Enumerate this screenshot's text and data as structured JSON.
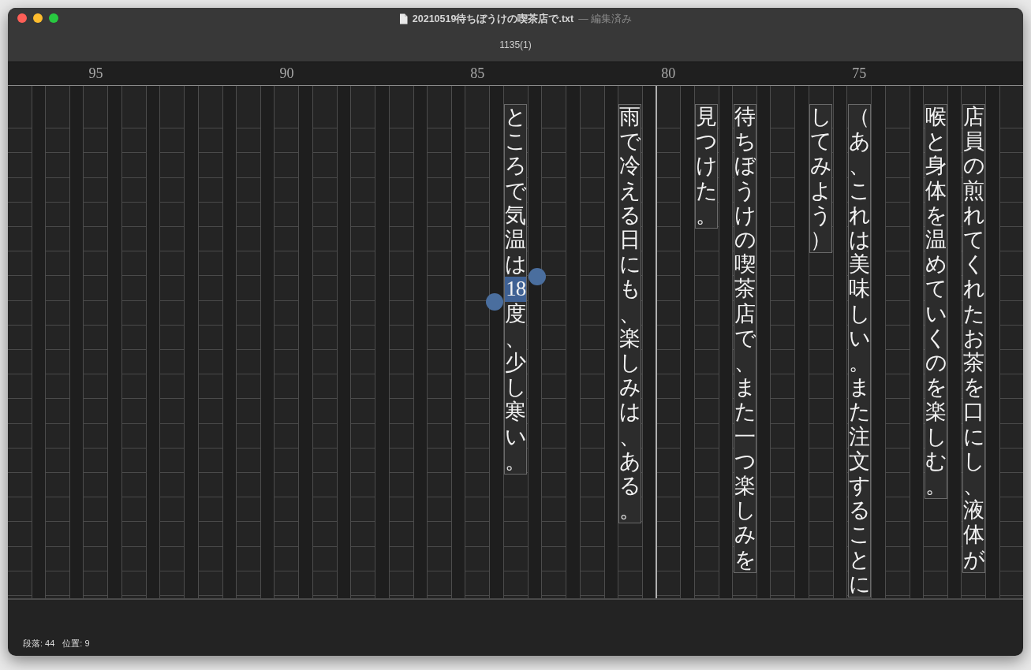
{
  "window": {
    "title": "20210519待ちぼうけの喫茶店で.txt",
    "subtitle_state": "— 編集済み",
    "page_info": "1135(1)"
  },
  "lines": [
    {
      "kind": "blank"
    },
    {
      "kind": "blank"
    },
    {
      "kind": "blank",
      "ruler_label": "95"
    },
    {
      "kind": "blank"
    },
    {
      "kind": "blank"
    },
    {
      "kind": "blank"
    },
    {
      "kind": "blank"
    },
    {
      "kind": "blank",
      "ruler_label": "90"
    },
    {
      "kind": "blank"
    },
    {
      "kind": "blank"
    },
    {
      "kind": "blank"
    },
    {
      "kind": "blank"
    },
    {
      "kind": "blank",
      "ruler_label": "85"
    },
    {
      "kind": "text",
      "segments": [
        {
          "text": "ところで気温は",
          "selected": false
        },
        {
          "text": "18",
          "selected": true
        },
        {
          "text": "度、少し寒い。",
          "selected": false
        }
      ]
    },
    {
      "kind": "blank"
    },
    {
      "kind": "blank"
    },
    {
      "kind": "text",
      "segments": [
        {
          "text": "雨で冷える日にも、楽しみは、ある。",
          "selected": false
        }
      ]
    },
    {
      "kind": "fold",
      "ruler_label": "80"
    },
    {
      "kind": "text",
      "segments": [
        {
          "text": "見つけた。",
          "selected": false
        }
      ]
    },
    {
      "kind": "text",
      "segments": [
        {
          "text": "待ちぼうけの喫茶店で、また一つ楽しみを",
          "selected": false
        }
      ]
    },
    {
      "kind": "blank"
    },
    {
      "kind": "text",
      "segments": [
        {
          "text": "してみよう）",
          "selected": false
        }
      ]
    },
    {
      "kind": "text",
      "ruler_label": "75",
      "segments": [
        {
          "text": "（あ、これは美味しい。また注文することに",
          "selected": false
        }
      ]
    },
    {
      "kind": "blank"
    },
    {
      "kind": "text",
      "segments": [
        {
          "text": "喉と身体を温めていくのを楽しむ。",
          "selected": false
        }
      ]
    },
    {
      "kind": "text",
      "segments": [
        {
          "text": "店員の煎れてくれたお茶を口にし、液体が",
          "selected": false
        }
      ]
    },
    {
      "kind": "blank"
    }
  ],
  "status_bar": {
    "paragraph": "段落: 44",
    "position": "位置: 9"
  }
}
